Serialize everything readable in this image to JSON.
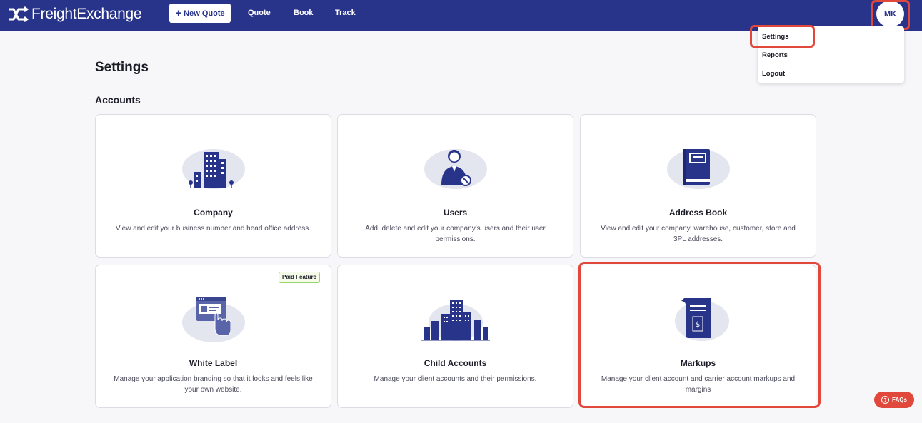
{
  "header": {
    "brand": "FreightExchange",
    "new_quote_label": "New Quote",
    "nav": [
      "Quote",
      "Book",
      "Track"
    ],
    "avatar_initials": "MK"
  },
  "user_menu": {
    "items": [
      "Settings",
      "Reports",
      "Logout"
    ],
    "highlighted": "Settings"
  },
  "page": {
    "title": "Settings",
    "section": "Accounts"
  },
  "cards": [
    {
      "title": "Company",
      "description": "View and edit your business number and head office address.",
      "icon": "building-icon"
    },
    {
      "title": "Users",
      "description": "Add, delete and edit your company's users and their user permissions.",
      "icon": "user-icon"
    },
    {
      "title": "Address Book",
      "description": "View and edit your company, warehouse, customer, store and 3PL addresses.",
      "icon": "address-book-icon"
    },
    {
      "title": "White Label",
      "description": "Manage your application branding so that it looks and feels like your own website.",
      "icon": "browser-hand-icon",
      "badge": "Paid Feature"
    },
    {
      "title": "Child Accounts",
      "description": "Manage your client accounts and their permissions.",
      "icon": "city-icon"
    },
    {
      "title": "Markups",
      "description": "Manage your client account and carrier account markups and margins",
      "icon": "invoice-dollar-icon"
    }
  ],
  "faq_label": "FAQs",
  "colors": {
    "brand_navy": "#28338a",
    "highlight_red": "#e0483c",
    "icon_bg": "#e3e5ef",
    "paid_badge_border": "#9bd36b"
  }
}
